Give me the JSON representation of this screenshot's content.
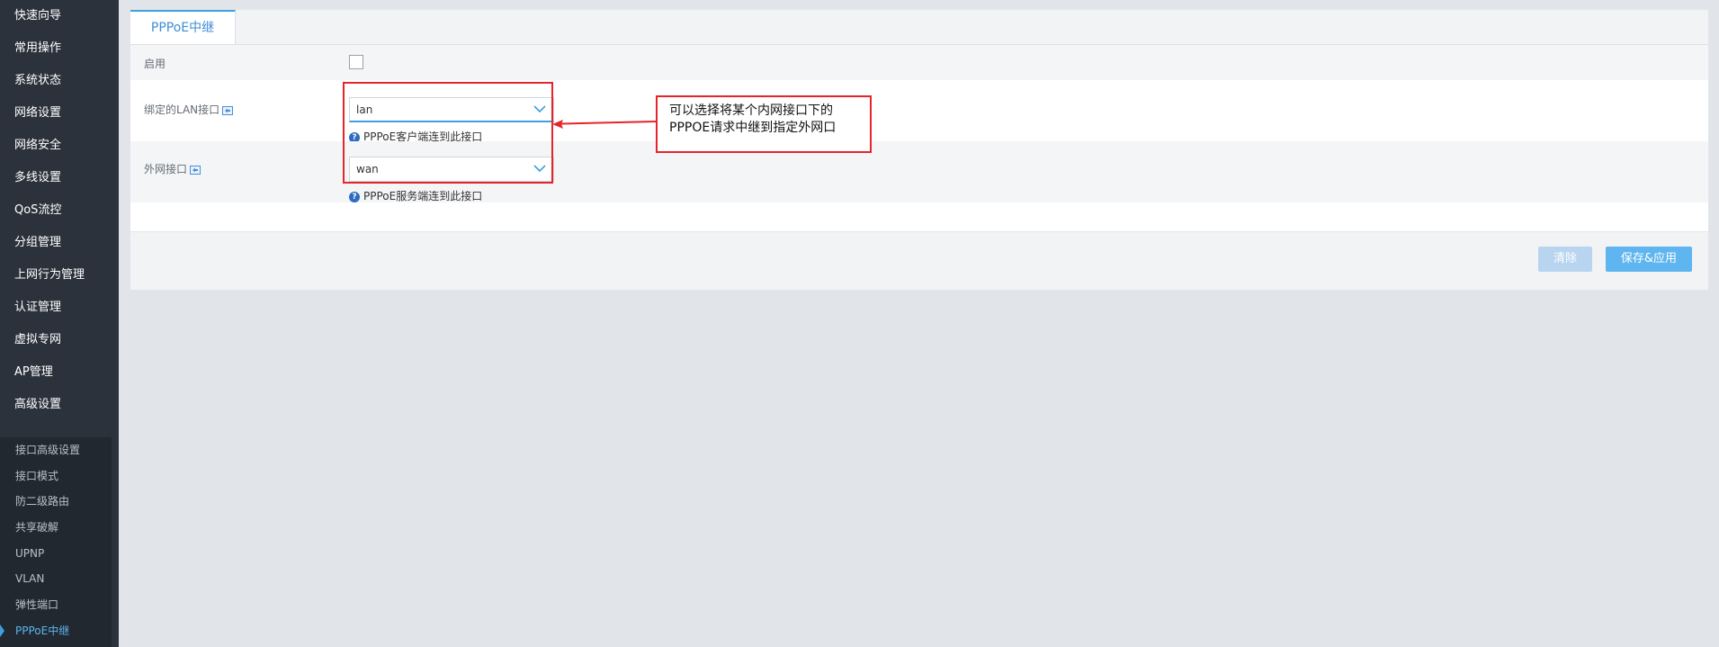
{
  "sidebar": {
    "items": [
      {
        "label": "快速向导"
      },
      {
        "label": "常用操作"
      },
      {
        "label": "系统状态"
      },
      {
        "label": "网络设置"
      },
      {
        "label": "网络安全"
      },
      {
        "label": "多线设置"
      },
      {
        "label": "QoS流控"
      },
      {
        "label": "分组管理"
      },
      {
        "label": "上网行为管理"
      },
      {
        "label": "认证管理"
      },
      {
        "label": "虚拟专网"
      },
      {
        "label": "AP管理"
      },
      {
        "label": "高级设置"
      }
    ],
    "subitems": [
      {
        "label": "接口高级设置"
      },
      {
        "label": "接口模式"
      },
      {
        "label": "防二级路由"
      },
      {
        "label": "共享破解"
      },
      {
        "label": "UPNP"
      },
      {
        "label": "VLAN"
      },
      {
        "label": "弹性端口"
      },
      {
        "label": "PPPoE中继"
      }
    ]
  },
  "tab": {
    "label": "PPPoE中继"
  },
  "form": {
    "enable_label": "启用",
    "enable_checked": false,
    "lan_label": "绑定的LAN接口",
    "lan_value": "lan",
    "lan_hint": "PPPoE客户端连到此接口",
    "wan_label": "外网接口",
    "wan_value": "wan",
    "wan_hint": "PPPoE服务端连到此接口"
  },
  "buttons": {
    "clear": "清除",
    "save": "保存&应用"
  },
  "annotation": {
    "line1": "可以选择将某个内网接口下的",
    "line2": "PPPOE请求中继到指定外网口"
  },
  "colors": {
    "sidebar_bg": "#2b323c",
    "accent": "#3da0e0",
    "annotation_red": "#e5252a"
  }
}
